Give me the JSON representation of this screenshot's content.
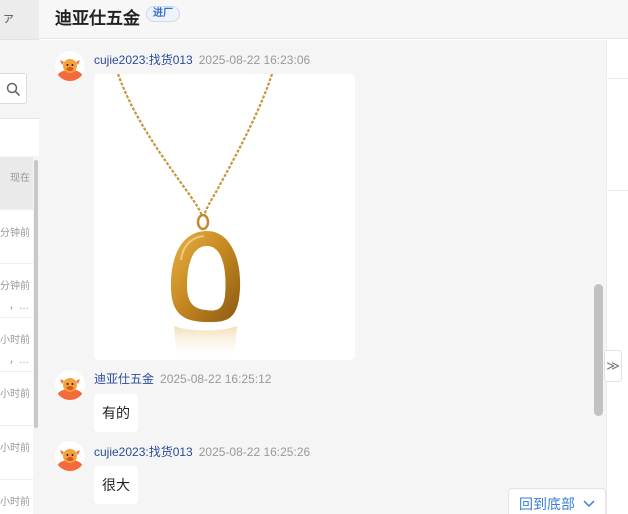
{
  "header": {
    "shop_name": "迪亚仕五金",
    "badge": "进厂"
  },
  "sidebar": {
    "top_glyph": "ァ",
    "search_icon": "search-icon",
    "conversations": [
      {
        "time": "现在",
        "snippet": ""
      },
      {
        "time": "分钟前",
        "snippet": ""
      },
      {
        "time": "分钟前",
        "snippet": "，…"
      },
      {
        "time": "小时前",
        "snippet": "，…"
      },
      {
        "time": "小时前",
        "snippet": ""
      },
      {
        "time": "小时前",
        "snippet": ""
      },
      {
        "time": "小时前",
        "snippet": ""
      }
    ]
  },
  "chat": {
    "messages": [
      {
        "sender": "cujie2023:找货013",
        "time": "2025-08-22 16:23:06",
        "type": "image",
        "image": "gold oval pendant necklace"
      },
      {
        "sender": "迪亚仕五金",
        "time": "2025-08-22 16:25:12",
        "type": "text",
        "text": "有的"
      },
      {
        "sender": "cujie2023:找货013",
        "time": "2025-08-22 16:25:26",
        "type": "text",
        "text": "很大"
      }
    ],
    "scroll_to_bottom": "回到底部"
  },
  "right_panel": {
    "expand_icon": "double-chevron-right-icon",
    "expand_glyph": "≫"
  },
  "colors": {
    "accent": "#3a7fd1",
    "sender": "#2b4a9a",
    "avatar": "#f36b3c",
    "chat_bg": "#f5f5f5"
  }
}
